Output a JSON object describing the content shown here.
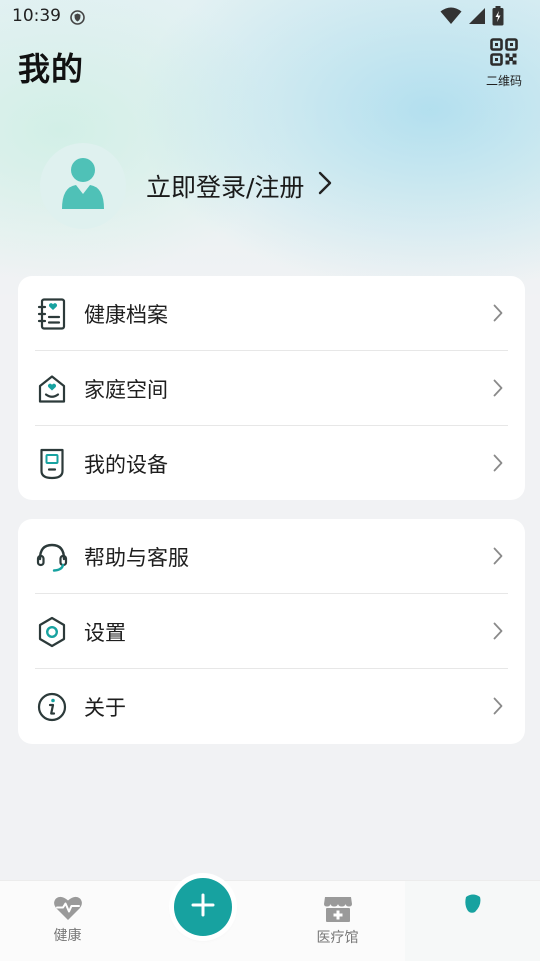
{
  "status_bar": {
    "time": "10:39",
    "icons": [
      "shield-icon",
      "wifi-icon",
      "signal-icon",
      "battery-charging-icon"
    ]
  },
  "header": {
    "title": "我的",
    "qr_label": "二维码"
  },
  "profile": {
    "login_text": "立即登录/注册"
  },
  "menu_group_1": [
    {
      "label": "健康档案",
      "icon": "health-record-icon"
    },
    {
      "label": "家庭空间",
      "icon": "family-home-icon"
    },
    {
      "label": "我的设备",
      "icon": "device-icon"
    }
  ],
  "menu_group_2": [
    {
      "label": "帮助与客服",
      "icon": "headset-icon"
    },
    {
      "label": "设置",
      "icon": "settings-hexagon-icon"
    },
    {
      "label": "关于",
      "icon": "info-icon"
    }
  ],
  "tab_bar": {
    "health_label": "健康",
    "hospital_label": "医疗馆",
    "add_icon": "plus-icon"
  },
  "colors": {
    "accent": "#17a2a0",
    "icon_dark": "#2c3a3a"
  }
}
